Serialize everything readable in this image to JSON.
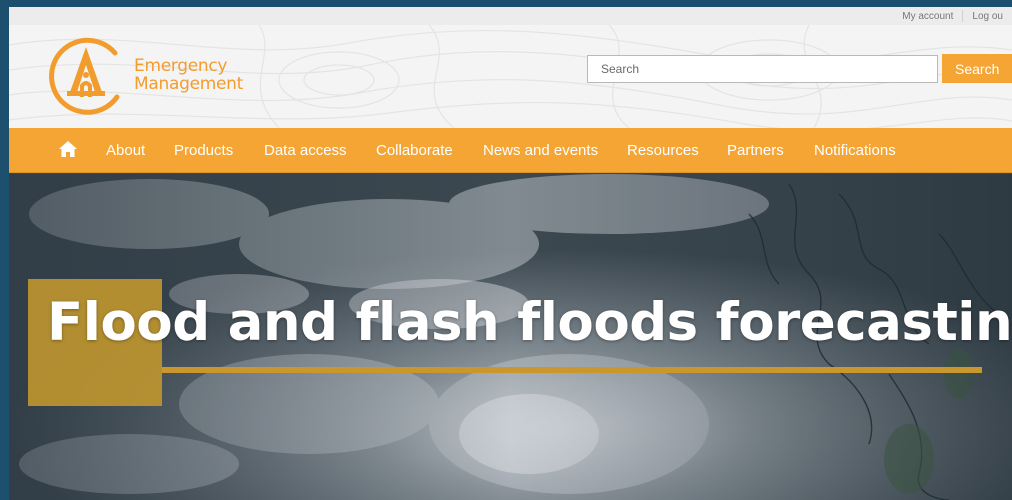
{
  "utility": {
    "my_account": "My account",
    "log_out": "Log ou"
  },
  "brand": {
    "line1": "Emergency",
    "line2": "Management",
    "color": "#f39c2e"
  },
  "search": {
    "placeholder": "Search",
    "button_label": "Search"
  },
  "nav": {
    "home_icon": "home-icon",
    "items": [
      {
        "label": "About"
      },
      {
        "label": "Products"
      },
      {
        "label": "Data access"
      },
      {
        "label": "Collaborate"
      },
      {
        "label": "News and events"
      },
      {
        "label": "Resources"
      },
      {
        "label": "Partners"
      },
      {
        "label": "Notifications"
      }
    ],
    "color": "#f4a534"
  },
  "hero": {
    "title": "Flood and flash floods forecasting",
    "accent_color": "#c9972d"
  }
}
